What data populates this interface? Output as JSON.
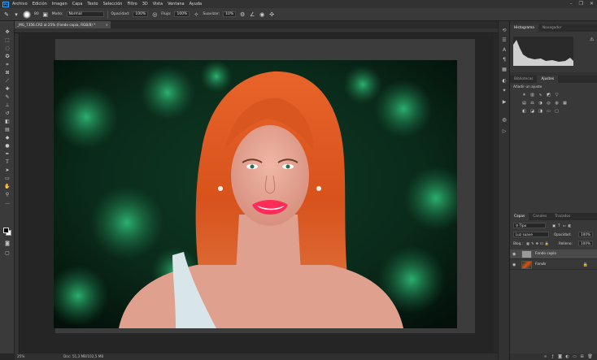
{
  "app": {
    "logo": "Ps"
  },
  "menu": [
    "Archivo",
    "Edición",
    "Imagen",
    "Capa",
    "Texto",
    "Selección",
    "Filtro",
    "3D",
    "Vista",
    "Ventana",
    "Ayuda"
  ],
  "window_controls": {
    "minimize": "–",
    "restore": "❐",
    "close": "✕"
  },
  "options": {
    "brush_size": "80",
    "mode_label": "Modo:",
    "mode_value": "Normal",
    "opacity_label": "Opacidad:",
    "opacity_value": "100%",
    "flow_label": "Flujo:",
    "flow_value": "100%",
    "smoothing_label": "Suavizar:",
    "smoothing_value": "10%"
  },
  "document": {
    "tab_title": "_MG_7356.CR2 al 25% (Fondo copia, RGB/8) *",
    "close": "×"
  },
  "status": {
    "zoom": "25%",
    "doc_size": "Doc: 51,3 MB/102,5 MB"
  },
  "panels": {
    "top_tabs": [
      "Histograma",
      "Navegador"
    ],
    "adj_tabs": [
      "Bibliotecas",
      "Ajustes"
    ],
    "adj_title": "Añadir un ajuste",
    "layer_tabs": [
      "Capas",
      "Canales",
      "Trazados"
    ],
    "kind_filter": "Tipo",
    "blend_mode": "Luz suave",
    "layer_opacity_label": "Opacidad:",
    "layer_opacity_value": "100%",
    "lock_label": "Bloq.:",
    "fill_label": "Relleno:",
    "fill_value": "100%",
    "layers": [
      {
        "name": "Fondo copia"
      },
      {
        "name": "Fondo"
      }
    ]
  },
  "colors": {
    "accent": "#31a8ff",
    "fg": "#000000",
    "bg": "#ffffff"
  }
}
